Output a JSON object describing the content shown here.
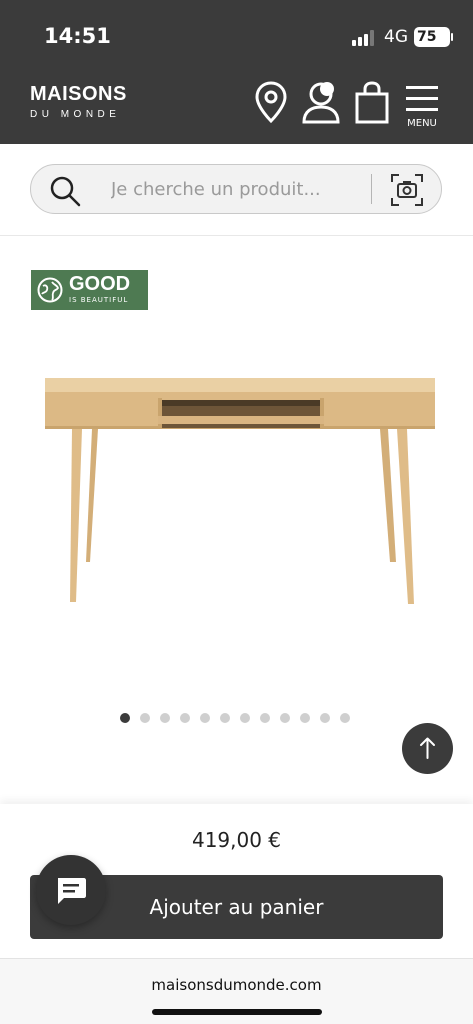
{
  "status_bar": {
    "time": "14:51",
    "network": "4G",
    "battery": "75"
  },
  "header": {
    "logo_main": "MAISONS",
    "logo_sub": "DU MONDE",
    "menu_label": "MENU"
  },
  "search": {
    "placeholder": "Je cherche un produit..."
  },
  "badge": {
    "title": "GOOD",
    "subtitle": "IS BEAUTIFUL"
  },
  "gallery": {
    "image_count": 12,
    "active_index": 1
  },
  "product": {
    "price": "419,00 €"
  },
  "actions": {
    "add_to_cart": "Ajouter au panier"
  },
  "browser": {
    "url": "maisonsdumonde.com"
  },
  "colors": {
    "header_bg": "#3b3b3b",
    "badge_green": "#4e7a52",
    "wood": "#e2c08f"
  }
}
